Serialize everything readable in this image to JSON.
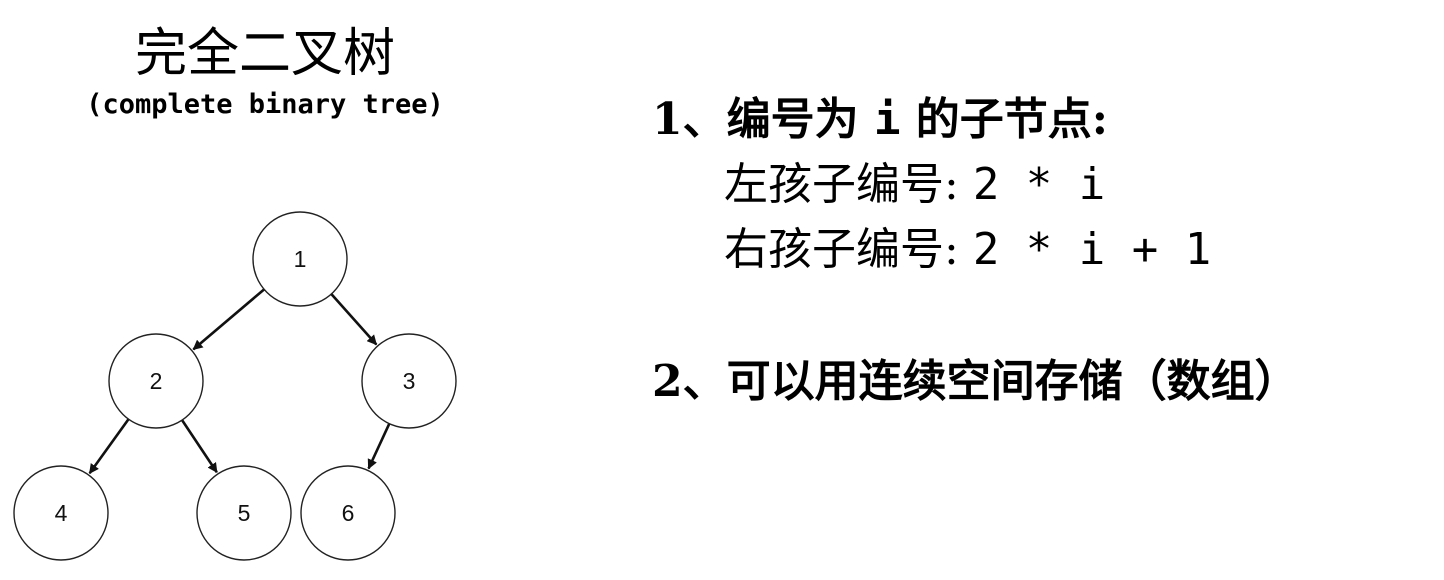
{
  "left_panel": {
    "title_cn": "完全二叉树",
    "title_en": "(complete binary tree)"
  },
  "tree": {
    "nodes": [
      {
        "id": "1",
        "label": "1"
      },
      {
        "id": "2",
        "label": "2"
      },
      {
        "id": "3",
        "label": "3"
      },
      {
        "id": "4",
        "label": "4"
      },
      {
        "id": "5",
        "label": "5"
      },
      {
        "id": "6",
        "label": "6"
      }
    ],
    "edges": [
      {
        "from": "1",
        "to": "2"
      },
      {
        "from": "1",
        "to": "3"
      },
      {
        "from": "2",
        "to": "4"
      },
      {
        "from": "2",
        "to": "5"
      },
      {
        "from": "3",
        "to": "6"
      }
    ]
  },
  "right_panel": {
    "point1": {
      "head": "1、编号为",
      "var": "i",
      "tail": "的子节点:",
      "left_label": "左孩子编号:",
      "left_formula": "2 * i",
      "right_label": "右孩子编号:",
      "right_formula": "2 * i + 1"
    },
    "point2": {
      "text": "2、可以用连续空间存储（数组）"
    }
  }
}
